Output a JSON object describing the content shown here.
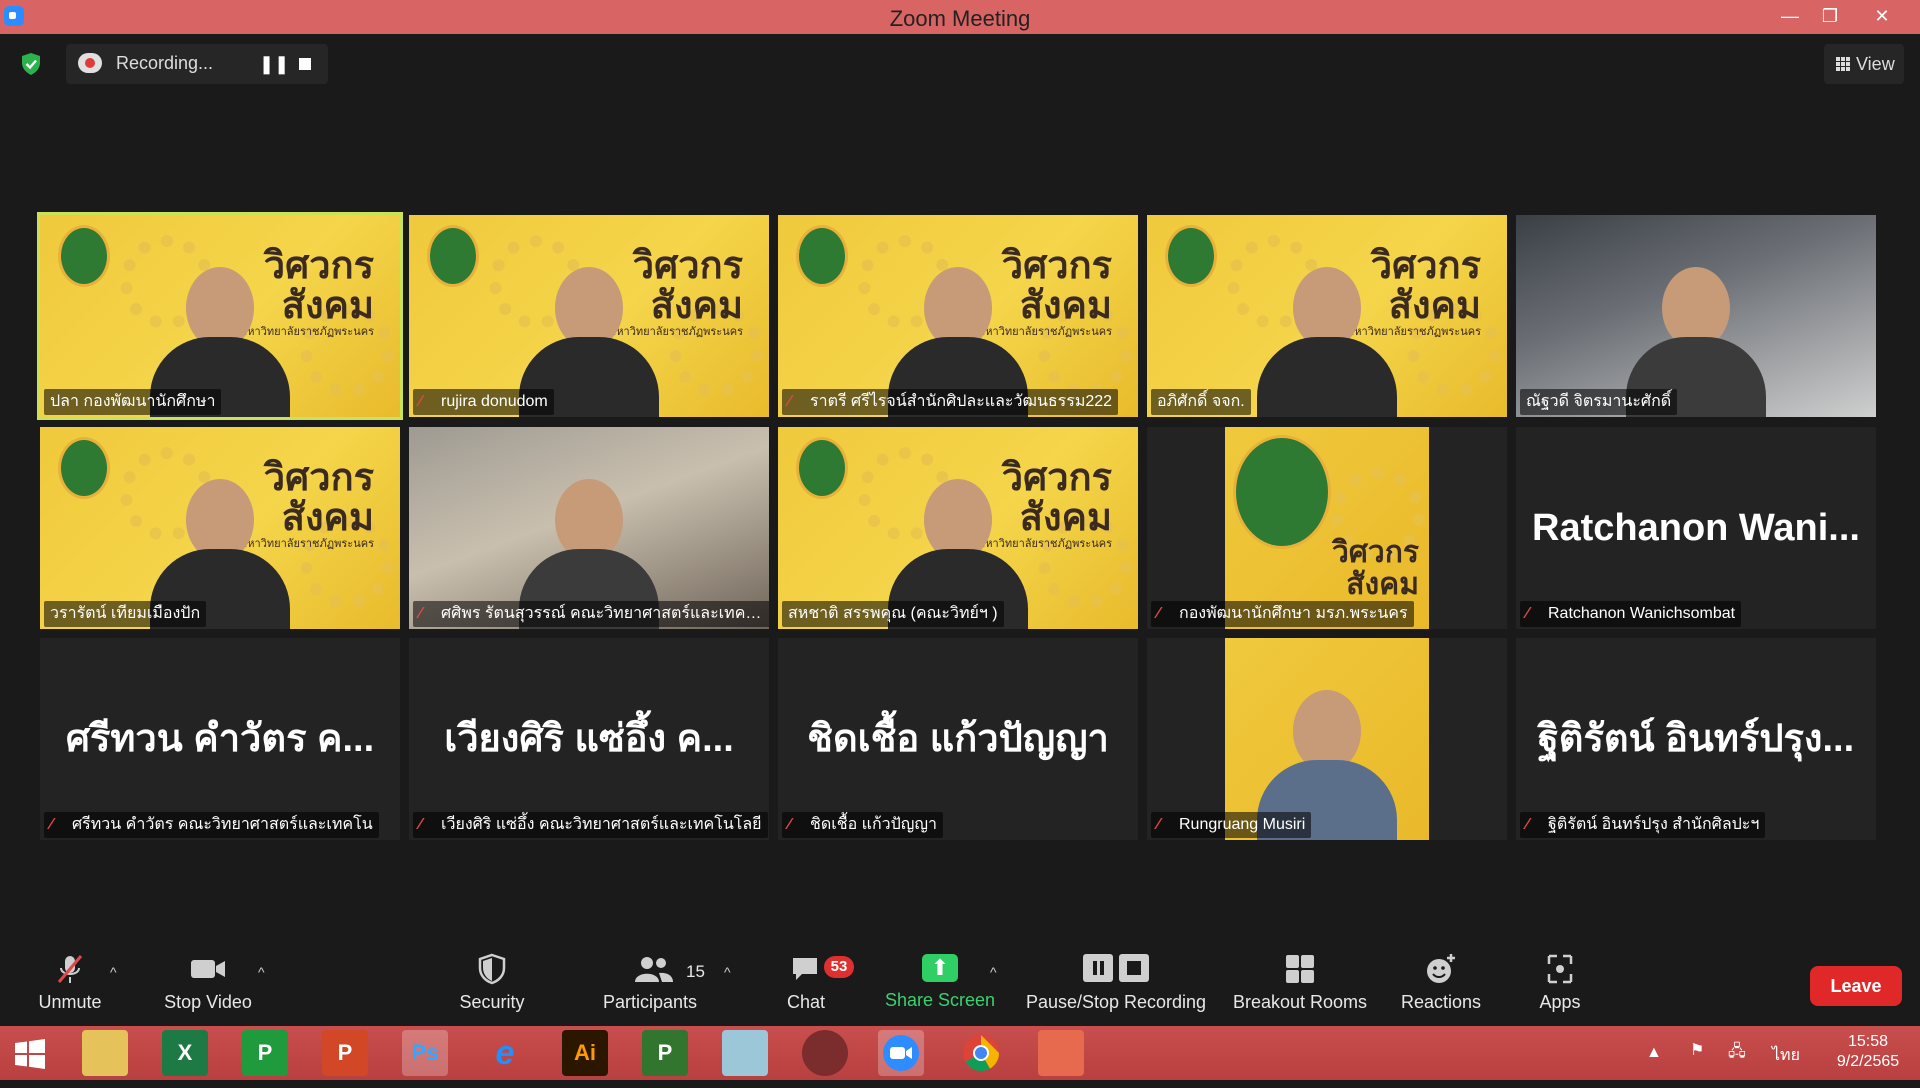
{
  "window": {
    "title": "Zoom Meeting",
    "minimize": "—",
    "restore": "❐",
    "close": "✕"
  },
  "topbar": {
    "recording_label": "Recording...",
    "pause_glyph": "❚❚",
    "view_label": "View"
  },
  "tiles": [
    {
      "name": "ปลา กองพัฒนานักศึกษา",
      "muted": false,
      "active": true,
      "kind": "yellow"
    },
    {
      "name": "rujira donudom",
      "muted": true,
      "kind": "yellow"
    },
    {
      "name": "ราตรี  ศรีไรจน์สำนักศิปละและวัฒนธรรม222",
      "muted": true,
      "kind": "yellow"
    },
    {
      "name": "อภิศักดิ์ จจก.",
      "muted": false,
      "kind": "yellow"
    },
    {
      "name": "ณัฐวดี จิตรมานะศักดิ์",
      "muted": false,
      "kind": "office"
    },
    {
      "name": "วรารัตน์ เทียมเมืองปัก",
      "muted": false,
      "kind": "yellow"
    },
    {
      "name": "ศศิพร รัตนสุวรรณ์ คณะวิทยาศาสตร์และเทคโน...",
      "muted": true,
      "kind": "photo"
    },
    {
      "name": "สหชาติ สรรพคุณ (คณะวิทย์ฯ )",
      "muted": false,
      "kind": "yellow"
    },
    {
      "name": "กองพัฒนานักศึกษา มรภ.พระนคร",
      "muted": true,
      "kind": "logo"
    },
    {
      "name": "Ratchanon Wanichsombat",
      "muted": true,
      "kind": "text",
      "overlay": "Ratchanon  Wani..."
    },
    {
      "name": "ศรีทวน  คำวัตร คณะวิทยาศาสตร์และเทคโน",
      "muted": true,
      "kind": "text",
      "overlay": "ศรีทวน  คำวัตร ค..."
    },
    {
      "name": "เวียงศิริ  แซ่อึ้ง  คณะวิทยาศาสตร์และเทคโนโลยี",
      "muted": true,
      "kind": "text",
      "overlay": "เวียงศิริ  แซ่อึ้ง  ค..."
    },
    {
      "name": "ชิดเชื้อ แก้วปัญญา",
      "muted": true,
      "kind": "text",
      "overlay": "ชิดเชื้อ แก้วปัญญา"
    },
    {
      "name": "Rungruang Musiri",
      "muted": true,
      "kind": "logo-person"
    },
    {
      "name": "ฐิติรัตน์ อินทร์ปรุง สำนักศิลปะฯ",
      "muted": true,
      "kind": "text",
      "overlay": "ฐิติรัตน์ อินทร์ปรุง..."
    }
  ],
  "banner_text": {
    "line1": "วิศวกร",
    "line2": "สังคม",
    "sub": "มหาวิทยาลัยราชภัฏพระนคร"
  },
  "toolbar": {
    "unmute": "Unmute",
    "stop_video": "Stop Video",
    "security": "Security",
    "participants": "Participants",
    "participants_count": "15",
    "chat": "Chat",
    "chat_badge": "53",
    "share_screen": "Share Screen",
    "pause_stop_recording": "Pause/Stop Recording",
    "breakout_rooms": "Breakout Rooms",
    "reactions": "Reactions",
    "apps": "Apps",
    "leave": "Leave",
    "caret": "^"
  },
  "taskbar": {
    "apps": [
      "windows-start",
      "file-explorer",
      "excel",
      "publisher-green",
      "powerpoint",
      "photoshop",
      "internet-explorer",
      "illustrator",
      "project",
      "notes",
      "photoscape",
      "zoom",
      "chrome",
      "office-picture"
    ],
    "icon_labels": {
      "excel": "X",
      "publisher": "P",
      "powerpoint": "P",
      "photoshop": "Ps",
      "ie": "e",
      "illustrator": "Ai",
      "project": "P"
    },
    "language": "ไทย",
    "time": "15:58",
    "date": "9/2/2565"
  },
  "colors": {
    "titlebar": "#d96464",
    "active_speaker": "#c9e25a",
    "leave": "#e02828",
    "share": "#2fcf66",
    "mic_muted": "#e04848"
  }
}
